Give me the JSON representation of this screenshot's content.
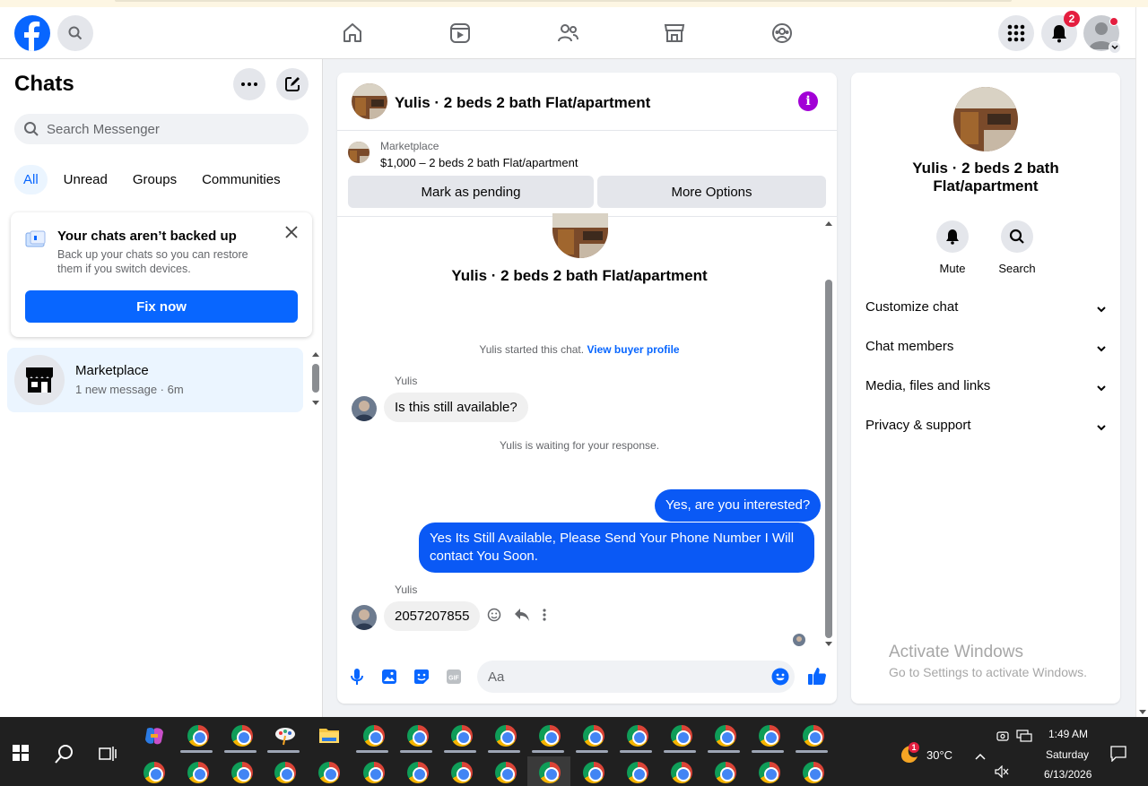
{
  "top_nav": {
    "notif_count": "2",
    "icons": [
      "home-icon",
      "video-icon",
      "friends-icon",
      "marketplace-icon",
      "groups-icon"
    ]
  },
  "left": {
    "title": "Chats",
    "search_placeholder": "Search Messenger",
    "filters": [
      "All",
      "Unread",
      "Groups",
      "Communities"
    ],
    "backup": {
      "title": "Your chats aren’t backed up",
      "desc": "Back up your chats so you can restore them if you switch devices.",
      "button": "Fix now"
    },
    "chat_item": {
      "name": "Marketplace",
      "sub": "1 new message · 6m"
    }
  },
  "conversation": {
    "title": "Yulis · 2 beds 2 bath Flat/apartment",
    "marketplace_label": "Marketplace",
    "listing": "$1,000 – 2 beds 2 bath Flat/apartment",
    "btn_pending": "Mark as pending",
    "btn_more": "More Options",
    "thread_title": "Yulis · 2 beds 2 bath Flat/apartment",
    "started_text": "Yulis started this chat.",
    "buyer_profile_link": "View buyer profile",
    "sender_name": "Yulis",
    "msg1": "Is this still available?",
    "waiting_text": "Yulis is waiting for your response.",
    "msg2": "Yes, are you interested?",
    "msg3": "Yes Its Still Available, Please Send Your Phone Number I Will contact You Soon.",
    "msg4": "2057207855",
    "composer_placeholder": "Aa"
  },
  "right_panel": {
    "title": "Yulis · 2 beds 2 bath Flat/apartment",
    "actions": [
      "Mute",
      "Search"
    ],
    "rows": [
      "Customize chat",
      "Chat members",
      "Media, files and links",
      "Privacy & support"
    ],
    "activate_title": "Activate Windows",
    "activate_desc": "Go to Settings to activate Windows."
  },
  "taskbar": {
    "temperature": "30°C",
    "weather_badge": "1",
    "time": "1:49 AM",
    "day": "Saturday",
    "date": "6/13/2026"
  },
  "colors": {
    "brand_blue": "#0866ff",
    "outgoing_bubble": "#0a59f5",
    "info_purple": "#a200d6",
    "badge_red": "#e41e3f"
  }
}
